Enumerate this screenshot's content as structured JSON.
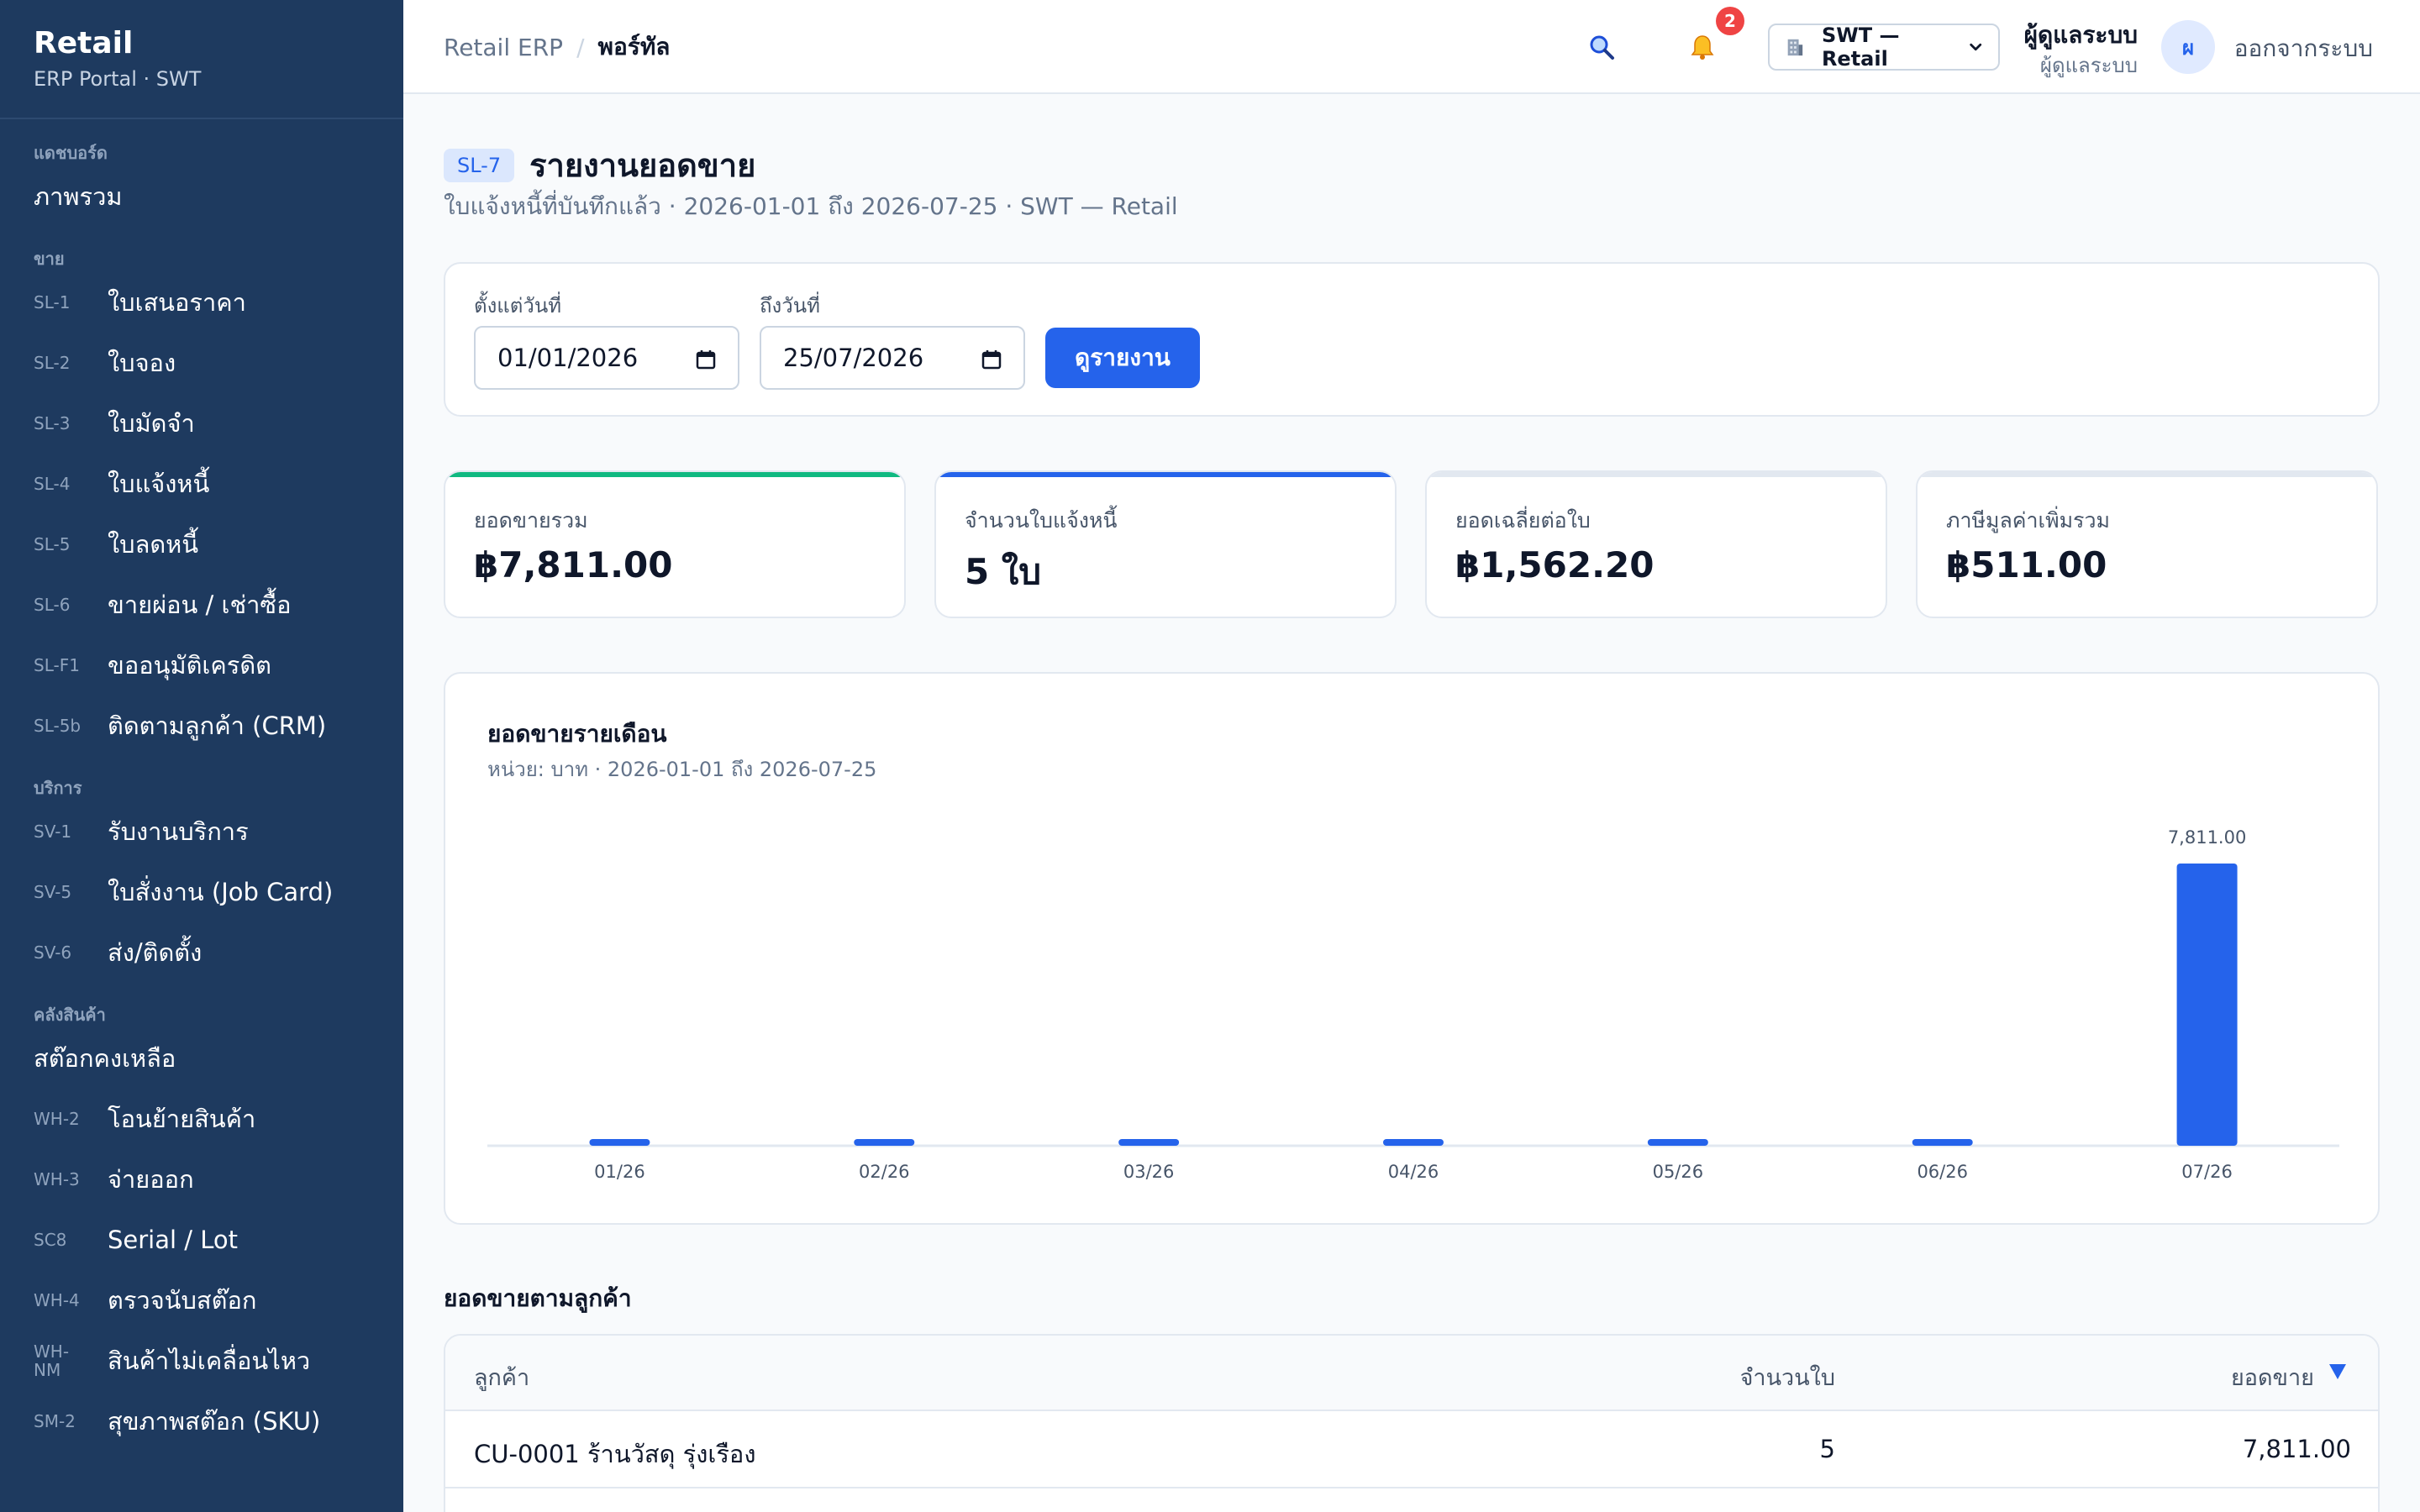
{
  "sidebar": {
    "brand_title": "Retail",
    "brand_sub": "ERP Portal · SWT",
    "sections": [
      {
        "title": "แดชบอร์ด",
        "items": [
          {
            "code": "",
            "label": "ภาพรวม"
          }
        ]
      },
      {
        "title": "ขาย",
        "items": [
          {
            "code": "SL-1",
            "label": "ใบเสนอราคา"
          },
          {
            "code": "SL-2",
            "label": "ใบจอง"
          },
          {
            "code": "SL-3",
            "label": "ใบมัดจำ"
          },
          {
            "code": "SL-4",
            "label": "ใบแจ้งหนี้"
          },
          {
            "code": "SL-5",
            "label": "ใบลดหนี้"
          },
          {
            "code": "SL-6",
            "label": "ขายผ่อน / เช่าซื้อ"
          },
          {
            "code": "SL-F1",
            "label": "ขออนุมัติเครดิต"
          },
          {
            "code": "SL-5b",
            "label": "ติดตามลูกค้า (CRM)"
          }
        ]
      },
      {
        "title": "บริการ",
        "items": [
          {
            "code": "SV-1",
            "label": "รับงานบริการ"
          },
          {
            "code": "SV-5",
            "label": "ใบสั่งงาน (Job Card)"
          },
          {
            "code": "SV-6",
            "label": "ส่ง/ติดตั้ง"
          }
        ]
      },
      {
        "title": "คลังสินค้า",
        "items": [
          {
            "code": "",
            "label": "สต๊อกคงเหลือ"
          },
          {
            "code": "WH-2",
            "label": "โอนย้ายสินค้า"
          },
          {
            "code": "WH-3",
            "label": "จ่ายออก"
          },
          {
            "code": "SC8",
            "label": "Serial / Lot"
          },
          {
            "code": "WH-4",
            "label": "ตรวจนับสต๊อก"
          },
          {
            "code": "WH-NM",
            "label": "สินค้าไม่เคลื่อนไหว"
          },
          {
            "code": "SM-2",
            "label": "สุขภาพสต๊อก (SKU)"
          }
        ]
      }
    ]
  },
  "topbar": {
    "crumb_root": "Retail ERP",
    "crumb_sep": "/",
    "crumb_current": "พอร์ทัล",
    "notif_count": "2",
    "company": "SWT — Retail",
    "user_name": "ผู้ดูแลระบบ",
    "user_role": "ผู้ดูแลระบบ",
    "avatar_initial": "ผ",
    "logout": "ออกจากระบบ",
    "icons": {
      "search": "search-icon",
      "bell": "bell-icon",
      "building": "building-icon",
      "chevron": "chevron-down-icon"
    }
  },
  "page": {
    "code": "SL-7",
    "title": "รายงานยอดขาย",
    "subtitle": "ใบแจ้งหนี้ที่บันทึกแล้ว · 2026-01-01 ถึง 2026-07-25 · SWT — Retail"
  },
  "filters": {
    "from_label": "ตั้งแต่วันที่",
    "from_value": "01/01/2026",
    "to_label": "ถึงวันที่",
    "to_value": "25/07/2026",
    "run_label": "ดูรายงาน"
  },
  "kpis": [
    {
      "label": "ยอดขายรวม",
      "value": "฿7,811.00",
      "accent": "#10b981"
    },
    {
      "label": "จำนวนใบแจ้งหนี้",
      "value": "5 ใบ",
      "accent": "#2563eb"
    },
    {
      "label": "ยอดเฉลี่ยต่อใบ",
      "value": "฿1,562.20",
      "accent": "#e2e8f0"
    },
    {
      "label": "ภาษีมูลค่าเพิ่มรวม",
      "value": "฿511.00",
      "accent": "#e2e8f0"
    }
  ],
  "chart": {
    "title": "ยอดขายรายเดือน",
    "subtitle": "หน่วย: บาท · 2026-01-01 ถึง 2026-07-25"
  },
  "chart_data": {
    "type": "bar",
    "categories": [
      "01/26",
      "02/26",
      "03/26",
      "04/26",
      "05/26",
      "06/26",
      "07/26"
    ],
    "values": [
      0,
      0,
      0,
      0,
      0,
      0,
      7811
    ],
    "data_labels": [
      "",
      "",
      "",
      "",
      "",
      "",
      "7,811.00"
    ],
    "title": "ยอดขายรายเดือน",
    "xlabel": "",
    "ylabel": "",
    "bar_color": "#2563eb",
    "grid": false
  },
  "customers": {
    "title": "ยอดขายตามลูกค้า",
    "headers": {
      "customer": "ลูกค้า",
      "count": "จำนวนใบ",
      "amount": "ยอดขาย",
      "sort_icon": "sort-desc-icon"
    },
    "rows": [
      {
        "customer": "CU-0001 ร้านวัสดุ รุ่งเรือง",
        "count": "5",
        "amount": "7,811.00"
      }
    ]
  }
}
